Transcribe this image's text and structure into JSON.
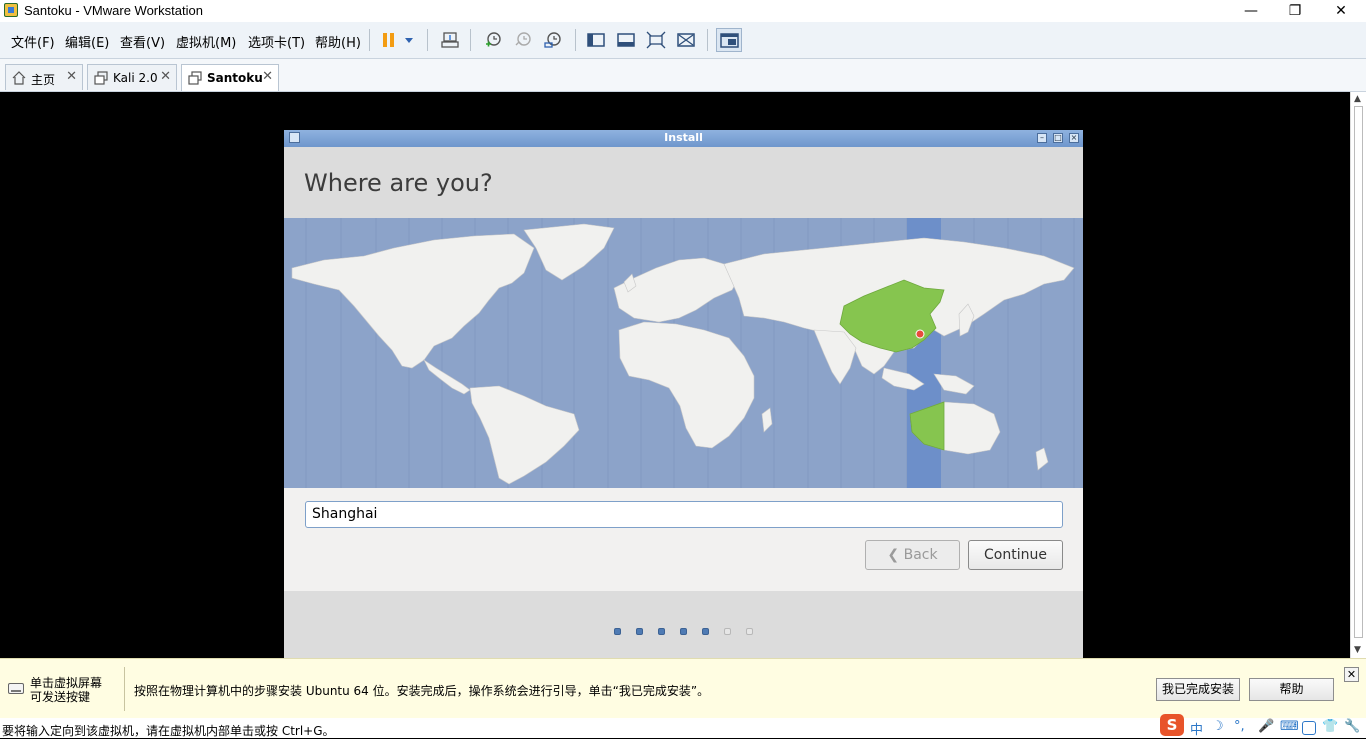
{
  "window": {
    "title": "Santoku - VMware Workstation",
    "controls": {
      "minimize": "—",
      "maximize": "❐",
      "close": "✕"
    }
  },
  "menu": [
    {
      "label": "文件(F)"
    },
    {
      "label": "编辑(E)"
    },
    {
      "label": "查看(V)"
    },
    {
      "label": "虚拟机(M)"
    },
    {
      "label": "选项卡(T)"
    },
    {
      "label": "帮助(H)"
    }
  ],
  "toolbar_icons": [
    "pause-icon",
    "dropdown-icon",
    "send-ctrl-alt-del-icon",
    "snapshot-take-icon",
    "snapshot-revert-icon",
    "snapshot-manager-icon",
    "sidebar-toggle-icon",
    "console-view-icon",
    "fullscreen-icon",
    "unity-icon",
    "library-view-icon"
  ],
  "tabs": [
    {
      "label": "主页",
      "icon": "home-icon",
      "close": "✕",
      "active": false
    },
    {
      "label": "Kali 2.0",
      "icon": "vm-icon",
      "close": "✕",
      "active": false
    },
    {
      "label": "Santoku",
      "icon": "vm-icon",
      "close": "✕",
      "active": true
    }
  ],
  "installer": {
    "window_title": "Install",
    "heading": "Where are you?",
    "location_value": "Shanghai",
    "back_label": "Back",
    "back_arrow": "❮",
    "continue_label": "Continue",
    "progress": {
      "total": 7,
      "completed": 5
    },
    "colors": {
      "ocean": "#8ca3c9",
      "land": "#f1f1ef",
      "selected_country": "#86c54f",
      "timezone_band": "#6d8fc9",
      "marker": "#e74c3c"
    }
  },
  "hint": {
    "left_line1": "单击虚拟屏幕",
    "left_line2": "可发送按键",
    "message": "按照在物理计算机中的步骤安装 Ubuntu 64 位。安装完成后，操作系统会进行引导，单击“我已完成安装”。",
    "finish_button": "我已完成安装",
    "help_button": "帮助",
    "close": "✕"
  },
  "status": {
    "text": "要将输入定向到该虚拟机，请在虚拟机内部单击或按 Ctrl+G。",
    "ime": {
      "logo": "S",
      "mode": "中",
      "moon": "☽",
      "punct": "°,",
      "mic": "🎤",
      "keyboard": "⌨",
      "skin": "👕",
      "tools": "🔧"
    }
  }
}
